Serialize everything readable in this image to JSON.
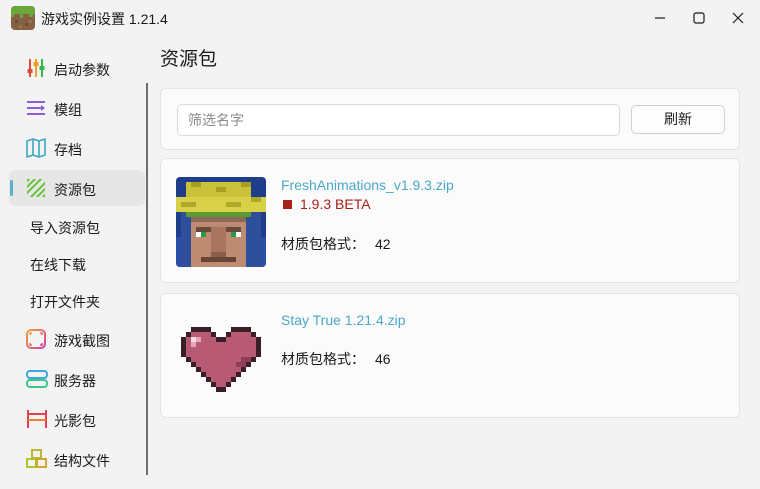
{
  "window": {
    "title": "游戏实例设置 1.21.4",
    "controls": [
      "minimize-icon",
      "maximize-icon",
      "close-icon"
    ]
  },
  "sidebar": {
    "items": [
      {
        "label": "启动参数",
        "icon": "sliders-icon",
        "active": false
      },
      {
        "label": "模组",
        "icon": "list-icon",
        "active": false
      },
      {
        "label": "存档",
        "icon": "map-icon",
        "active": false
      },
      {
        "label": "资源包",
        "icon": "striped-square-icon",
        "active": true
      },
      {
        "label": "导入资源包",
        "sub": true
      },
      {
        "label": "在线下载",
        "sub": true
      },
      {
        "label": "打开文件夹",
        "sub": true
      },
      {
        "label": "游戏截图",
        "icon": "screenshot-icon",
        "active": false
      },
      {
        "label": "服务器",
        "icon": "server-icon",
        "active": false
      },
      {
        "label": "光影包",
        "icon": "shader-icon",
        "active": false
      },
      {
        "label": "结构文件",
        "icon": "blocks-icon",
        "active": false
      }
    ]
  },
  "main": {
    "title": "资源包",
    "search": {
      "placeholder": "筛选名字",
      "value": ""
    },
    "refresh_label": "刷新",
    "packs": [
      {
        "name": "FreshAnimations_v1.9.3.zip",
        "version": "1.9.3 BETA",
        "format_label": "材质包格式：",
        "format": "42",
        "icon": "villager-icon"
      },
      {
        "name": "Stay True 1.21.4.zip",
        "format_label": "材质包格式：",
        "format": "46",
        "icon": "heart-icon"
      }
    ]
  },
  "colors": {
    "accent": "#5ab0c8",
    "link": "#4ba8c8",
    "beta": "#a8201a"
  }
}
